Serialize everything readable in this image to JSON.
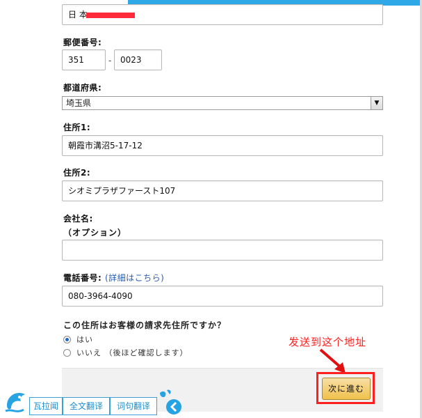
{
  "address_form": {
    "name_value": "日 本",
    "postal_label": "郵便番号:",
    "postal_part1": "351",
    "postal_sep": "-",
    "postal_part2": "0023",
    "prefecture_label": "都道府県:",
    "prefecture_value": "埼玉県",
    "address1_label": "住所1:",
    "address1_value": "朝霞市溝沼5-17-12",
    "address2_label": "住所2:",
    "address2_value": "シオミプラザファースト107",
    "company_label": "会社名:",
    "company_optional": "（オプション）",
    "company_value": "",
    "phone_label": "電話番号:",
    "phone_detail_link": "(詳細はこちら)",
    "phone_value": "080-3964-4090",
    "billing_question": "この住所はお客様の請求先住所ですか？",
    "option_yes": "はい",
    "option_no": "いいえ （後ほど確認します）",
    "next_button": "次に進む"
  },
  "annotation": {
    "note": "发送到这个地址",
    "color": "#ff2020"
  },
  "translator_toolbar": {
    "items": [
      "瓦拉闻",
      "全文翻译",
      "词句翻译"
    ],
    "accent": "#1d8ed0"
  }
}
